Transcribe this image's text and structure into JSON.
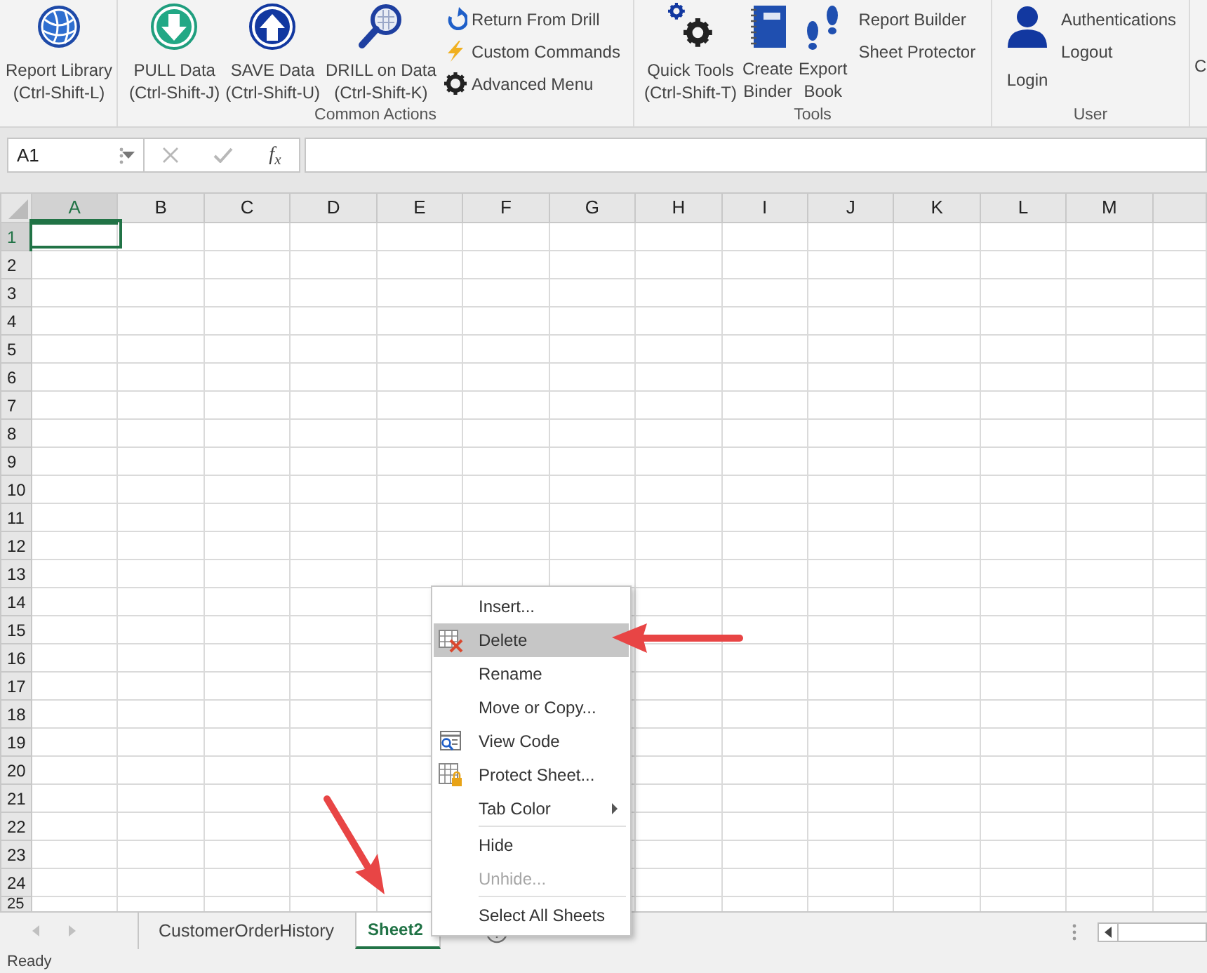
{
  "ribbon": {
    "groups": [
      {
        "items": [
          {
            "kind": "large",
            "label": "Report Library",
            "shortcut": "(Ctrl-Shift-L)"
          }
        ]
      },
      {
        "label": "Common Actions",
        "items": [
          {
            "kind": "large",
            "label": "PULL Data",
            "shortcut": "(Ctrl-Shift-J)"
          },
          {
            "kind": "large",
            "label": "SAVE Data",
            "shortcut": "(Ctrl-Shift-U)"
          },
          {
            "kind": "large",
            "label": "DRILL on Data",
            "shortcut": "(Ctrl-Shift-K)"
          },
          {
            "kind": "small",
            "entries": [
              "Return From Drill",
              "Custom Commands",
              "Advanced Menu"
            ]
          }
        ]
      },
      {
        "label": "Tools",
        "items": [
          {
            "kind": "large",
            "label": "Quick Tools",
            "shortcut": "(Ctrl-Shift-T)"
          },
          {
            "kind": "large",
            "label": "Create Binder"
          },
          {
            "kind": "large",
            "label": "Export Book"
          },
          {
            "kind": "small",
            "entries": [
              "Report Builder",
              "Sheet Protector"
            ]
          }
        ]
      },
      {
        "label": "User",
        "items": [
          {
            "kind": "large",
            "label": "Login"
          },
          {
            "kind": "small",
            "entries": [
              "Authentications",
              "Logout"
            ]
          }
        ]
      },
      {
        "items": [
          {
            "kind": "cut",
            "label": "C"
          }
        ]
      }
    ]
  },
  "formula_bar": {
    "name_box": "A1",
    "fx": "f$_{x}$",
    "cancel_disabled": true,
    "enter_disabled": true
  },
  "grid": {
    "columns": [
      {
        "label": "A",
        "selected": true
      },
      {
        "label": "B",
        "selected": false
      },
      {
        "label": "C",
        "selected": false
      },
      {
        "label": "D",
        "selected": false
      },
      {
        "label": "E",
        "selected": false
      },
      {
        "label": "F",
        "selected": false
      },
      {
        "label": "G",
        "selected": false
      },
      {
        "label": "H",
        "selected": false
      },
      {
        "label": "I",
        "selected": false
      },
      {
        "label": "J",
        "selected": false
      },
      {
        "label": "K",
        "selected": false
      },
      {
        "label": "L",
        "selected": false
      },
      {
        "label": "M",
        "selected": false
      }
    ],
    "rows": [
      {
        "label": "1",
        "selected": true
      },
      {
        "label": "2",
        "selected": false
      },
      {
        "label": "3",
        "selected": false
      },
      {
        "label": "4",
        "selected": false
      },
      {
        "label": "5",
        "selected": false
      },
      {
        "label": "6",
        "selected": false
      },
      {
        "label": "7",
        "selected": false
      },
      {
        "label": "8",
        "selected": false
      },
      {
        "label": "9",
        "selected": false
      },
      {
        "label": "10",
        "selected": false
      },
      {
        "label": "11",
        "selected": false
      },
      {
        "label": "12",
        "selected": false
      },
      {
        "label": "13",
        "selected": false
      },
      {
        "label": "14",
        "selected": false
      },
      {
        "label": "15",
        "selected": false
      },
      {
        "label": "16",
        "selected": false
      },
      {
        "label": "17",
        "selected": false
      },
      {
        "label": "18",
        "selected": false
      },
      {
        "label": "19",
        "selected": false
      },
      {
        "label": "20",
        "selected": false
      },
      {
        "label": "21",
        "selected": false
      },
      {
        "label": "22",
        "selected": false
      },
      {
        "label": "23",
        "selected": false
      },
      {
        "label": "24",
        "selected": false
      },
      {
        "label": "25",
        "selected": false
      }
    ]
  },
  "sheet_tabs": [
    {
      "label": "CustomerOrderHistory",
      "selected": false
    },
    {
      "label": "Sheet2",
      "selected": true
    }
  ],
  "context_menu": [
    {
      "label": "Insert...",
      "selected": false,
      "disabled": false,
      "separator_before": false,
      "submenu": false
    },
    {
      "label": "Delete",
      "selected": true,
      "disabled": false,
      "separator_before": false,
      "submenu": false
    },
    {
      "label": "Rename",
      "selected": false,
      "disabled": false,
      "separator_before": false,
      "submenu": false
    },
    {
      "label": "Move or Copy...",
      "selected": false,
      "disabled": false,
      "separator_before": false,
      "submenu": false
    },
    {
      "label": "View Code",
      "selected": false,
      "disabled": false,
      "separator_before": false,
      "submenu": false
    },
    {
      "label": "Protect Sheet...",
      "selected": false,
      "disabled": false,
      "separator_before": false,
      "submenu": false
    },
    {
      "label": "Tab Color",
      "selected": false,
      "disabled": false,
      "separator_before": false,
      "submenu": true
    },
    {
      "label": "Hide",
      "selected": false,
      "disabled": false,
      "separator_before": true,
      "submenu": false
    },
    {
      "label": "Unhide...",
      "selected": false,
      "disabled": true,
      "separator_before": false,
      "submenu": false
    },
    {
      "label": "Select All Sheets",
      "selected": false,
      "disabled": false,
      "separator_before": true,
      "submenu": false
    }
  ],
  "status_bar": {
    "text": "Ready"
  }
}
